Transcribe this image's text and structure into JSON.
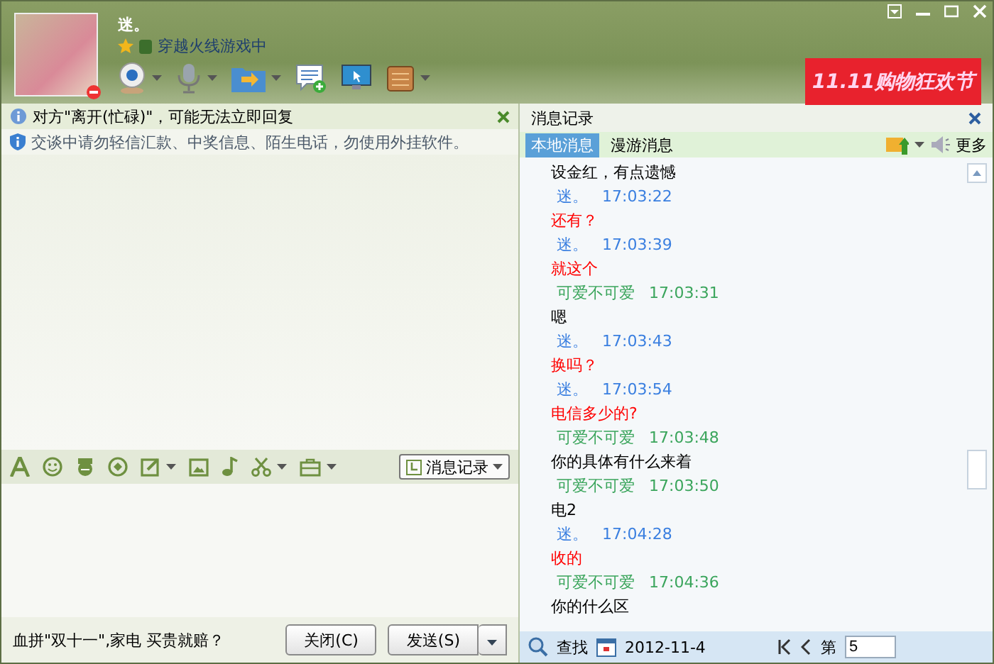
{
  "contact": {
    "name": "迷。",
    "status": "穿越火线游戏中"
  },
  "banner": {
    "text": "11.11购物狂欢节"
  },
  "notices": [
    {
      "kind": "away",
      "text": "对方\"离开(忙碌)\"，可能无法立即回复"
    },
    {
      "kind": "security",
      "text": "交谈中请勿轻信汇款、中奖信息、陌生电话，勿使用外挂软件。"
    }
  ],
  "history_button": "消息记录",
  "footer": {
    "ad": "血拼\"双十一\",家电 买贵就赔？",
    "close": "关闭(C)",
    "send": "发送(S)"
  },
  "history": {
    "title": "消息记录",
    "tabs": [
      {
        "label": "本地消息",
        "selected": true
      },
      {
        "label": "漫游消息",
        "selected": false
      }
    ],
    "more": "更多",
    "messages": [
      {
        "kind": "text",
        "text": "设金红，有点遗憾",
        "color": "#000000"
      },
      {
        "kind": "header",
        "name": "迷。",
        "time": "17:03:22",
        "color": "#3a7fe0"
      },
      {
        "kind": "text",
        "text": "还有？",
        "color": "#ff0000"
      },
      {
        "kind": "header",
        "name": "迷。",
        "time": "17:03:39",
        "color": "#3a7fe0"
      },
      {
        "kind": "text",
        "text": "就这个",
        "color": "#ff0000"
      },
      {
        "kind": "header",
        "name": "可爱不可爱",
        "time": "17:03:31",
        "color": "#3ba55c"
      },
      {
        "kind": "text",
        "text": "嗯",
        "color": "#000000"
      },
      {
        "kind": "header",
        "name": "迷。",
        "time": "17:03:43",
        "color": "#3a7fe0"
      },
      {
        "kind": "text",
        "text": "换吗？",
        "color": "#ff0000"
      },
      {
        "kind": "header",
        "name": "迷。",
        "time": "17:03:54",
        "color": "#3a7fe0"
      },
      {
        "kind": "text",
        "text": "电信多少的?",
        "color": "#ff0000"
      },
      {
        "kind": "header",
        "name": "可爱不可爱",
        "time": "17:03:48",
        "color": "#3ba55c"
      },
      {
        "kind": "text",
        "text": "你的具体有什么来着",
        "color": "#000000"
      },
      {
        "kind": "header",
        "name": "可爱不可爱",
        "time": "17:03:50",
        "color": "#3ba55c"
      },
      {
        "kind": "text",
        "text": "电2",
        "color": "#000000"
      },
      {
        "kind": "header",
        "name": "迷。",
        "time": "17:04:28",
        "color": "#3a7fe0"
      },
      {
        "kind": "text",
        "text": "收的",
        "color": "#ff0000"
      },
      {
        "kind": "header",
        "name": "可爱不可爱",
        "time": "17:04:36",
        "color": "#3ba55c"
      },
      {
        "kind": "text",
        "text": "你的什么区",
        "color": "#000000"
      }
    ],
    "search": "查找",
    "date": "2012-11-4",
    "page_label": "第",
    "page": "5"
  }
}
